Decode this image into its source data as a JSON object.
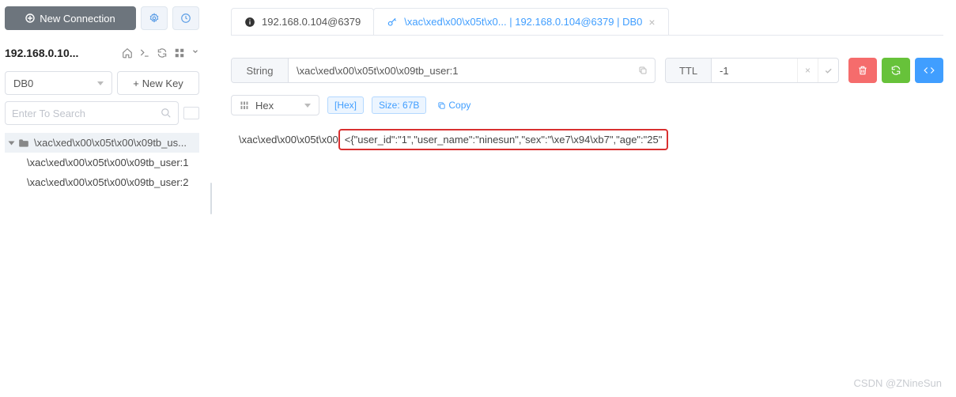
{
  "sidebar": {
    "new_connection": "New Connection",
    "connection_name": "192.168.0.10...",
    "db_selected": "DB0",
    "new_key": "New Key",
    "search_placeholder": "Enter To Search",
    "folder_label": "\\xac\\xed\\x00\\x05t\\x00\\x09tb_us...",
    "items": [
      "\\xac\\xed\\x00\\x05t\\x00\\x09tb_user:1",
      "\\xac\\xed\\x00\\x05t\\x00\\x09tb_user:2"
    ]
  },
  "tabs": {
    "info": "192.168.0.104@6379",
    "active": "\\xac\\xed\\x00\\x05t\\x0... | 192.168.0.104@6379 | DB0"
  },
  "key": {
    "type": "String",
    "name": "\\xac\\xed\\x00\\x05t\\x00\\x09tb_user:1",
    "ttl_label": "TTL",
    "ttl_value": "-1"
  },
  "view": {
    "mode": "Hex",
    "hex_tag": "[Hex]",
    "size_tag": "Size: 67B",
    "copy_tag": "Copy"
  },
  "value": {
    "prefix": "\\xac\\xed\\x00\\x05t\\x00",
    "highlight": "<{\"user_id\":\"1\",\"user_name\":\"ninesun\",\"sex\":\"\\xe7\\x94\\xb7\",\"age\":\"25\""
  },
  "watermark": "CSDN @ZNineSun"
}
